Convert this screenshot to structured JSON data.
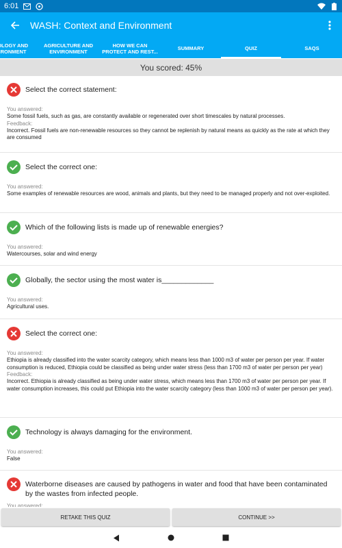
{
  "status_bar": {
    "time": "6:01",
    "icons": [
      "mail-icon",
      "data-saver-icon",
      "wifi-icon",
      "battery-icon"
    ]
  },
  "app_bar": {
    "title": "WASH: Context and Environment",
    "back_icon": "arrow-back-icon",
    "menu_icon": "overflow-menu-icon"
  },
  "tabs": [
    {
      "label": "NOLOGY AND\nVIRONMENT",
      "active": false
    },
    {
      "label": "AGRICULTURE AND\nENVIRONMENT",
      "active": false
    },
    {
      "label": "HOW WE CAN\nPROTECT AND REST...",
      "active": false
    },
    {
      "label": "SUMMARY",
      "active": false
    },
    {
      "label": "QUIZ",
      "active": true
    },
    {
      "label": "SAQS",
      "active": false
    }
  ],
  "score": "You scored: 45%",
  "labels": {
    "you_answered": "You answered:",
    "feedback": "Feedback:"
  },
  "questions": [
    {
      "status": "incorrect",
      "question": "Select the correct statement:",
      "answer": "Some fossil fuels, such as gas, are constantly available or regenerated over short timescales by natural processes.",
      "feedback": "Incorrect. Fossil fuels are non-renewable resources so they cannot be replenish by natural means as quickly as the rate at which they are consumed"
    },
    {
      "status": "correct",
      "question": "Select the correct one:",
      "answer": "Some examples of renewable resources are wood, animals and plants, but they need to be managed properly and not over-exploited.",
      "feedback": ""
    },
    {
      "status": "correct",
      "question": "Which of the following lists is made up of renewable energies?",
      "answer": "Watercourses, solar and wind energy",
      "feedback": ""
    },
    {
      "status": "correct",
      "question": "Globally, the sector using the most water is_____________",
      "answer": "Agricultural uses.",
      "feedback": ""
    },
    {
      "status": "incorrect",
      "question": "Select the correct one:",
      "answer": "Ethiopia is already classified into the water scarcity category, which means less than 1000 m3 of water per person per year. If water consumption is reduced, Ethiopia could be classified as being under water stress (less than 1700 m3 of water per person per year)",
      "feedback": "Incorrect. Ethiopia is already classified as being under water stress, which means less than 1700 m3 of water per person per year. If water consumption increases, this could put Ethiopia into the water scarcity category (less than 1000 m3 of water per person per year)."
    },
    {
      "status": "correct",
      "question": "Technology is always damaging for the environment.",
      "answer": "False",
      "feedback": ""
    },
    {
      "status": "incorrect",
      "question": "Waterborne diseases are caused by pathogens in water and food that have been contaminated by the wastes from infected people.",
      "answer": "",
      "feedback": ""
    }
  ],
  "buttons": {
    "retake": "RETAKE THIS QUIZ",
    "continue": "CONTINUE >>"
  },
  "nav": {
    "back_icon": "nav-back-icon",
    "home_icon": "nav-home-icon",
    "recents_icon": "nav-recents-icon"
  },
  "colors": {
    "status_bar": "#0277bd",
    "primary": "#03a9f4",
    "correct": "#4caf50",
    "incorrect": "#e53935",
    "score_bg": "#e0e0e0"
  }
}
